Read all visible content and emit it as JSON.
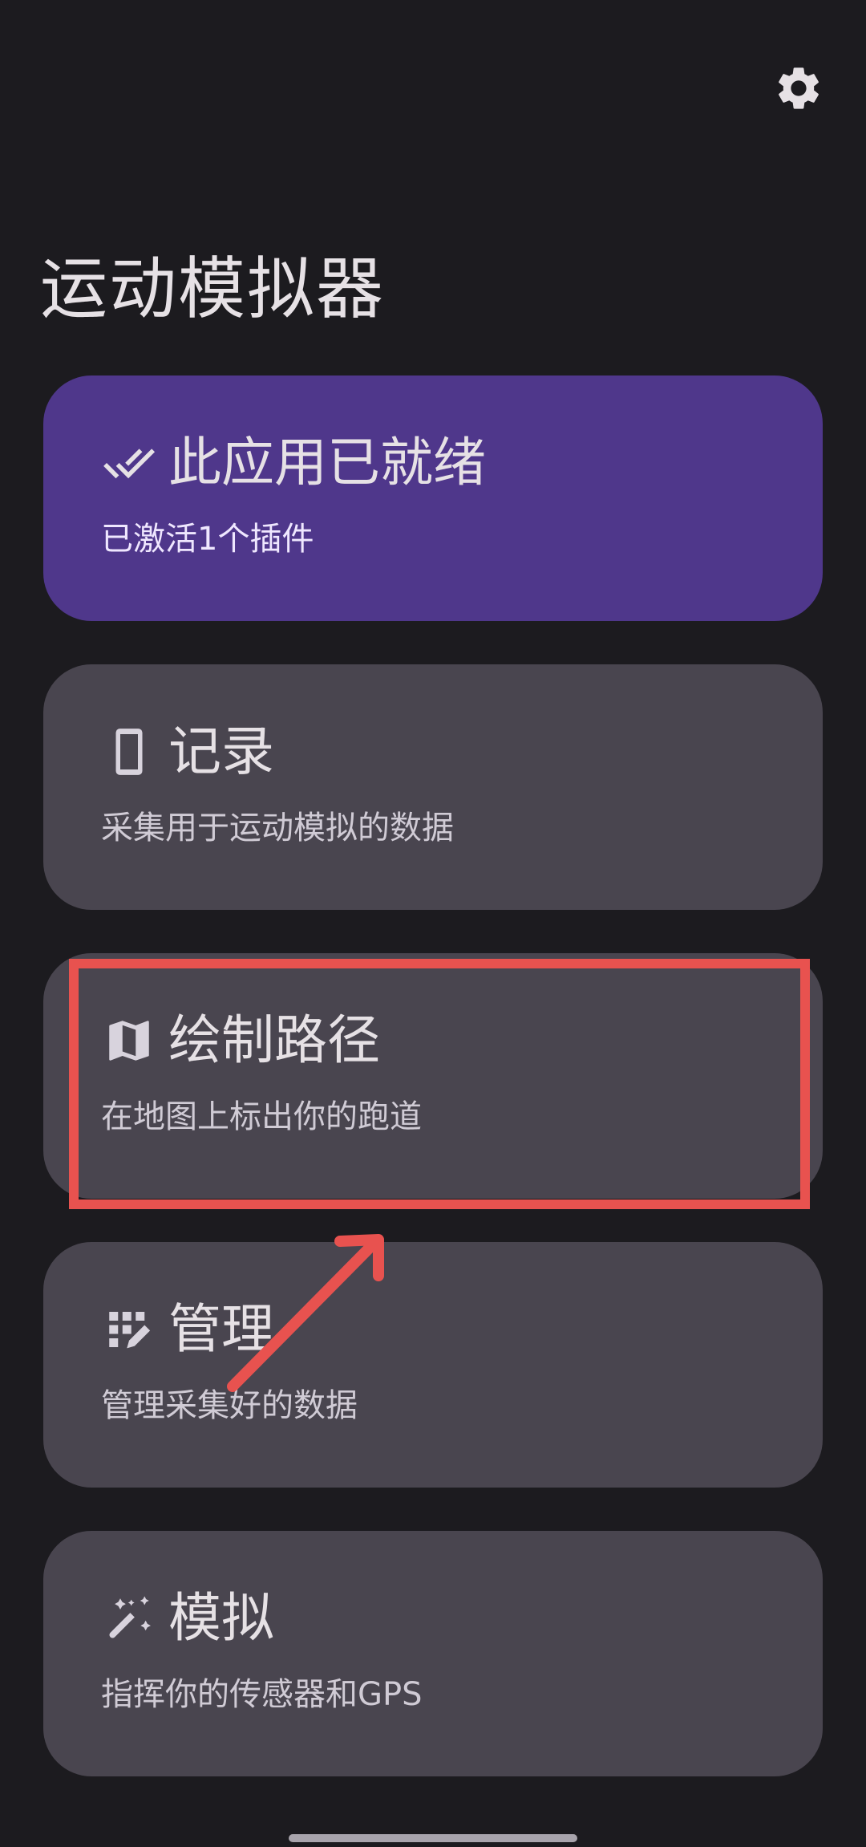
{
  "app": {
    "title": "运动模拟器"
  },
  "cards": [
    {
      "id": "ready",
      "icon": "double-check-icon",
      "title": "此应用已就绪",
      "subtitle": "已激活1个插件",
      "style": "primary"
    },
    {
      "id": "record",
      "icon": "phone-icon",
      "title": "记录",
      "subtitle": "采集用于运动模拟的数据"
    },
    {
      "id": "draw-route",
      "icon": "map-icon",
      "title": "绘制路径",
      "subtitle": "在地图上标出你的跑道"
    },
    {
      "id": "manage",
      "icon": "dashboard-edit-icon",
      "title": "管理",
      "subtitle": "管理采集好的数据"
    },
    {
      "id": "simulate",
      "icon": "magic-wand-icon",
      "title": "模拟",
      "subtitle": "指挥你的传感器和GPS"
    }
  ],
  "colors": {
    "background": "#1c1b1f",
    "card": "#49454f",
    "primary_card": "#4f378b",
    "annotation": "#e8524f"
  }
}
